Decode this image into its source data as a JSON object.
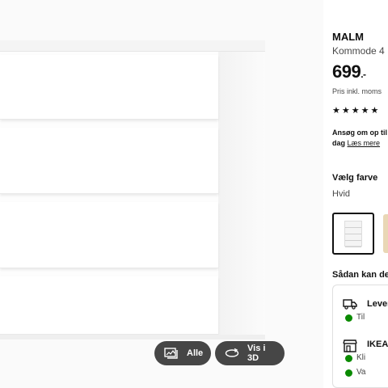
{
  "gallery": {
    "all_label": "Alle",
    "view_3d_label": "Vis i 3D"
  },
  "product": {
    "name": "MALM",
    "description": "Kommode 4",
    "price": "699",
    "price_suffix": ".-",
    "vat_note": "Pris inkl. moms",
    "rating_stars": "★★★★★",
    "apply_text": "Ansøg om op til",
    "apply_text_2": "dag",
    "read_more": "Læs mere"
  },
  "color": {
    "heading": "Vælg farve",
    "selected": "Hvid"
  },
  "purchase": {
    "heading": "Sådan kan de",
    "delivery": {
      "title": "Lever",
      "line": "Til"
    },
    "store": {
      "title": "IKEA",
      "line1": "Kli",
      "line2": "Va"
    }
  },
  "colors": {
    "available": "#0a8a00",
    "pill_bg": "#282828"
  }
}
